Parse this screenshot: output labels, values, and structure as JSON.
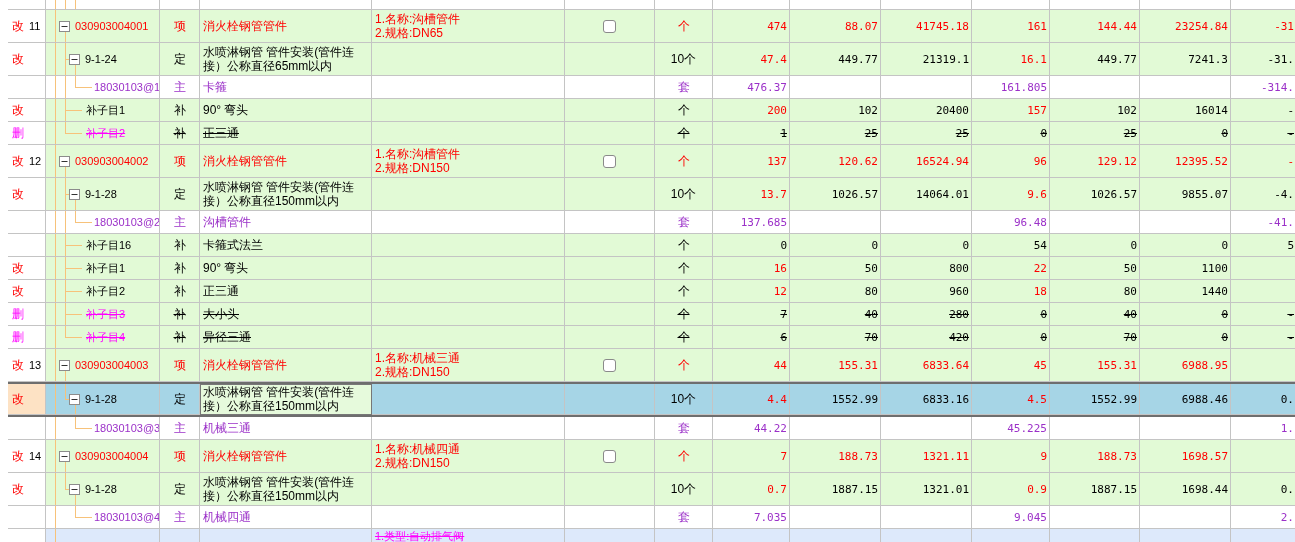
{
  "rows": [
    {
      "kind": "item",
      "modified": true,
      "deleted": false,
      "flag": "改",
      "number": "11",
      "selected": false,
      "expanded": true,
      "code": "030903004001",
      "type": "项",
      "name": "消火栓钢管管件",
      "spec": [
        "1.名称:沟槽管件",
        "2.规格:DN65"
      ],
      "checked": false,
      "unit": "个",
      "column_8": "474",
      "column_9": "88.07",
      "column_10": "41745.18",
      "column_11": "161",
      "column_12": "144.44",
      "column_13": "23254.84",
      "column_14": "-31",
      "children": [
        {
          "kind": "quota",
          "modified": true,
          "deleted": false,
          "flag": "改",
          "selected": false,
          "expanded": true,
          "code": "9-1-24",
          "type": "定",
          "name": "水喷淋钢管 管件安装(管件连接）公称直径65mm以内",
          "unit": "10个",
          "column_8": "47.4",
          "column_9": "449.77",
          "column_10": "21319.1",
          "column_11": "16.1",
          "column_12": "449.77",
          "column_13": "7241.3",
          "column_14": "-31.",
          "children": [
            {
              "kind": "main",
              "deleted": false,
              "selected": false,
              "code": "18030103@1",
              "type": "主",
              "name": "卡箍",
              "unit": "套",
              "column_8": "476.37",
              "column_11": "161.805",
              "column_14": "-314."
            }
          ]
        },
        {
          "kind": "sub",
          "modified": true,
          "deleted": false,
          "flag": "改",
          "selected": false,
          "code": "补子目1",
          "type": "补",
          "name": "90° 弯头",
          "unit": "个",
          "column_8": "200",
          "column_9": "102",
          "column_10": "20400",
          "column_11": "157",
          "column_12": "102",
          "column_13": "16014",
          "column_14": "-"
        },
        {
          "kind": "sub",
          "modified": false,
          "deleted": true,
          "flag": "删",
          "selected": false,
          "code": "补子目2",
          "type": "补",
          "name": "正三通",
          "unit": "个",
          "column_8": "1",
          "column_9": "25",
          "column_10": "25",
          "column_11": "0",
          "column_12": "25",
          "column_13": "0",
          "column_14": "-"
        }
      ]
    },
    {
      "kind": "item",
      "modified": true,
      "deleted": false,
      "flag": "改",
      "number": "12",
      "selected": false,
      "expanded": true,
      "code": "030903004002",
      "type": "项",
      "name": "消火栓钢管管件",
      "spec": [
        "1.名称:沟槽管件",
        "2.规格:DN150"
      ],
      "checked": false,
      "unit": "个",
      "column_8": "137",
      "column_9": "120.62",
      "column_10": "16524.94",
      "column_11": "96",
      "column_12": "129.12",
      "column_13": "12395.52",
      "column_14": "-",
      "children": [
        {
          "kind": "quota",
          "modified": true,
          "deleted": false,
          "flag": "改",
          "selected": false,
          "expanded": true,
          "code": "9-1-28",
          "type": "定",
          "name": "水喷淋钢管 管件安装(管件连接）公称直径150mm以内",
          "unit": "10个",
          "column_8": "13.7",
          "column_9": "1026.57",
          "column_10": "14064.01",
          "column_11": "9.6",
          "column_12": "1026.57",
          "column_13": "9855.07",
          "column_14": "-4.",
          "children": [
            {
              "kind": "main",
              "deleted": false,
              "selected": false,
              "code": "18030103@2",
              "type": "主",
              "name": "沟槽管件",
              "unit": "套",
              "column_8": "137.685",
              "column_11": "96.48",
              "column_14": "-41."
            }
          ]
        },
        {
          "kind": "sub",
          "modified": false,
          "deleted": false,
          "selected": false,
          "code": "补子目16",
          "type": "补",
          "name": "卡箍式法兰",
          "unit": "个",
          "column_8": "0",
          "column_9": "0",
          "column_10": "0",
          "column_11": "54",
          "column_12": "0",
          "column_13": "0",
          "column_14": "5"
        },
        {
          "kind": "sub",
          "modified": true,
          "deleted": false,
          "flag": "改",
          "selected": false,
          "code": "补子目1",
          "type": "补",
          "name": "90° 弯头",
          "unit": "个",
          "column_8": "16",
          "column_9": "50",
          "column_10": "800",
          "column_11": "22",
          "column_12": "50",
          "column_13": "1100"
        },
        {
          "kind": "sub",
          "modified": true,
          "deleted": false,
          "flag": "改",
          "selected": false,
          "code": "补子目2",
          "type": "补",
          "name": "正三通",
          "unit": "个",
          "column_8": "12",
          "column_9": "80",
          "column_10": "960",
          "column_11": "18",
          "column_12": "80",
          "column_13": "1440"
        },
        {
          "kind": "sub",
          "modified": false,
          "deleted": true,
          "flag": "删",
          "selected": false,
          "code": "补子目3",
          "type": "补",
          "name": "大小头",
          "unit": "个",
          "column_8": "7",
          "column_9": "40",
          "column_10": "280",
          "column_11": "0",
          "column_12": "40",
          "column_13": "0",
          "column_14": "-"
        },
        {
          "kind": "sub",
          "modified": false,
          "deleted": true,
          "flag": "删",
          "selected": false,
          "code": "补子目4",
          "type": "补",
          "name": "异径三通",
          "unit": "个",
          "column_8": "6",
          "column_9": "70",
          "column_10": "420",
          "column_11": "0",
          "column_12": "70",
          "column_13": "0",
          "column_14": "-"
        }
      ]
    },
    {
      "kind": "item",
      "modified": true,
      "deleted": false,
      "flag": "改",
      "number": "13",
      "selected": false,
      "expanded": true,
      "code": "030903004003",
      "type": "项",
      "name": "消火栓钢管管件",
      "spec": [
        "1.名称:机械三通",
        "2.规格:DN150"
      ],
      "checked": false,
      "unit": "个",
      "column_8": "44",
      "column_9": "155.31",
      "column_10": "6833.64",
      "column_11": "45",
      "column_12": "155.31",
      "column_13": "6988.95",
      "children": [
        {
          "kind": "quota",
          "modified": true,
          "deleted": false,
          "flag": "改",
          "selected": true,
          "expanded": true,
          "code": "9-1-28",
          "type": "定",
          "name": "水喷淋钢管 管件安装(管件连接）公称直径150mm以内",
          "unit": "10个",
          "column_8": "4.4",
          "column_9": "1552.99",
          "column_10": "6833.16",
          "column_11": "4.5",
          "column_12": "1552.99",
          "column_13": "6988.46",
          "column_14": "0.",
          "children": [
            {
              "kind": "main",
              "deleted": false,
              "selected": false,
              "code": "18030103@3",
              "type": "主",
              "name": "机械三通",
              "unit": "套",
              "column_8": "44.22",
              "column_11": "45.225",
              "column_14": "1."
            }
          ]
        }
      ]
    },
    {
      "kind": "item",
      "modified": true,
      "deleted": false,
      "flag": "改",
      "number": "14",
      "selected": false,
      "expanded": true,
      "code": "030903004004",
      "type": "项",
      "name": "消火栓钢管管件",
      "spec": [
        "1.名称:机械四通",
        "2.规格:DN150"
      ],
      "checked": false,
      "unit": "个",
      "column_8": "7",
      "column_9": "188.73",
      "column_10": "1321.11",
      "column_11": "9",
      "column_12": "188.73",
      "column_13": "1698.57",
      "children": [
        {
          "kind": "quota",
          "modified": true,
          "deleted": false,
          "flag": "改",
          "selected": false,
          "expanded": true,
          "code": "9-1-28",
          "type": "定",
          "name": "水喷淋钢管 管件安装(管件连接）公称直径150mm以内",
          "unit": "10个",
          "column_8": "0.7",
          "column_9": "1887.15",
          "column_10": "1321.01",
          "column_11": "0.9",
          "column_12": "1887.15",
          "column_13": "1698.44",
          "column_14": "0.",
          "children": [
            {
              "kind": "main",
              "deleted": false,
              "selected": false,
              "code": "18030103@4",
              "type": "主",
              "name": "机械四通",
              "unit": "套",
              "column_8": "7.035",
              "column_11": "9.045",
              "column_14": "2."
            }
          ]
        }
      ]
    },
    {
      "kind": "partial",
      "modified": false,
      "deleted": true,
      "selected": false,
      "spec": [
        "1.类型:自动排气阀"
      ]
    }
  ]
}
